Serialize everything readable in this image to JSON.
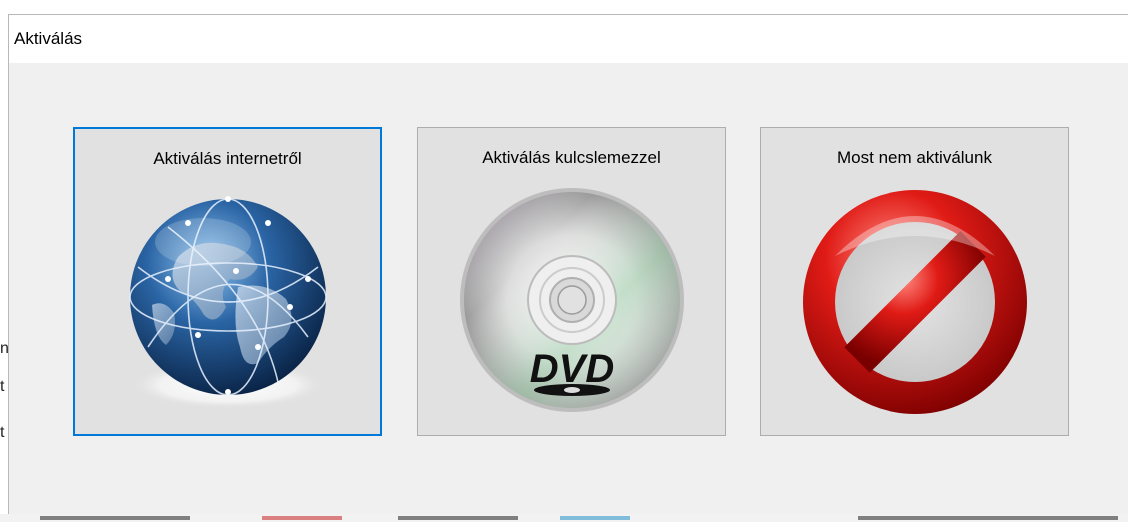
{
  "window": {
    "title": "Aktiválás"
  },
  "options": [
    {
      "label": "Aktiválás internetről",
      "icon": "globe-icon",
      "selected": true
    },
    {
      "label": "Aktiválás kulcslemezzel",
      "icon": "dvd-disc-icon",
      "selected": false
    },
    {
      "label": "Most nem aktiválunk",
      "icon": "prohibited-icon",
      "selected": false
    }
  ],
  "dvd_logo_text": "DVD",
  "colors": {
    "focus_border": "#0078d7",
    "button_face": "#e1e1e1",
    "window_bg": "#f0f0f0",
    "globe_blue": "#1c4f86",
    "prohibit_red": "#c8100e"
  }
}
